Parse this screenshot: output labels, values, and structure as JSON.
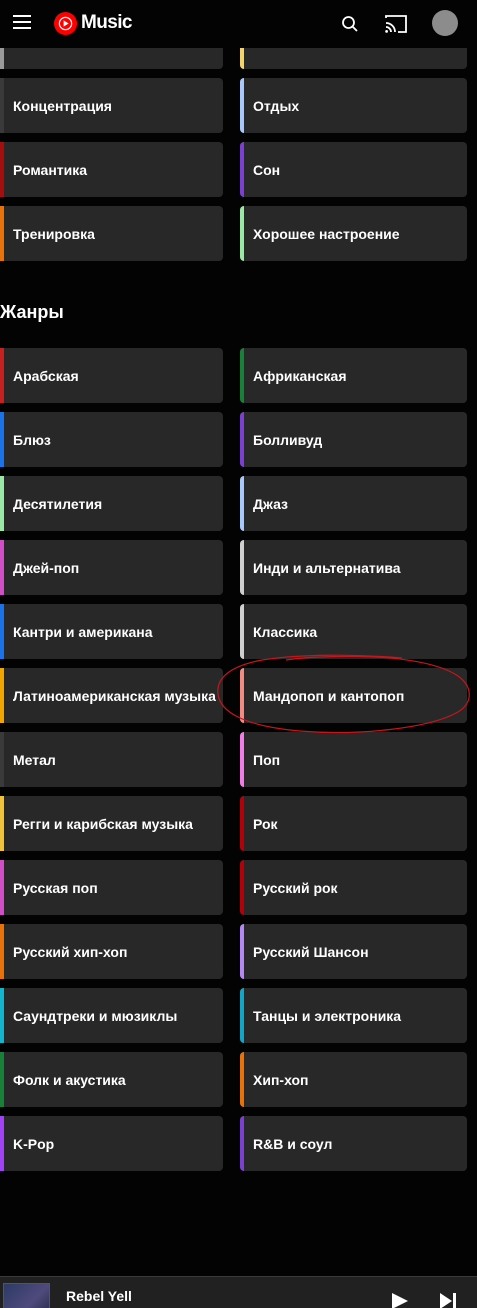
{
  "header": {
    "app_name": "Music",
    "icons": {
      "menu": "hamburger-menu-icon",
      "logo": "youtube-music-logo",
      "search": "search-icon",
      "cast": "cast-icon",
      "avatar": "account-avatar"
    }
  },
  "moods": {
    "tiles": [
      {
        "label": "",
        "color": "#9a9a9a"
      },
      {
        "label": "",
        "color": "#f5d36b"
      },
      {
        "label": "Концентрация",
        "color": "#3a3a3a"
      },
      {
        "label": "Отдых",
        "color": "#a8c7fa"
      },
      {
        "label": "Романтика",
        "color": "#a50e0e"
      },
      {
        "label": "Сон",
        "color": "#7b3fd1"
      },
      {
        "label": "Тренировка",
        "color": "#e8710a"
      },
      {
        "label": "Хорошее настроение",
        "color": "#9be7a5"
      }
    ]
  },
  "genres": {
    "title": "Жанры",
    "tiles": [
      {
        "label": "Арабская",
        "color": "#c5221f"
      },
      {
        "label": "Африканская",
        "color": "#188038"
      },
      {
        "label": "Блюз",
        "color": "#1a73e8"
      },
      {
        "label": "Болливуд",
        "color": "#7b3fd1"
      },
      {
        "label": "Десятилетия",
        "color": "#9be7a5"
      },
      {
        "label": "Джаз",
        "color": "#a8c7fa"
      },
      {
        "label": "Джей-поп",
        "color": "#d24ec7"
      },
      {
        "label": "Инди и альтернатива",
        "color": "#cfcfcf"
      },
      {
        "label": "Кантри и американа",
        "color": "#1a73e8"
      },
      {
        "label": "Классика",
        "color": "#cfcfcf"
      },
      {
        "label": "Латиноамериканская музыка",
        "color": "#f0a500"
      },
      {
        "label": "Мандопоп и кантопоп",
        "color": "#f28b82"
      },
      {
        "label": "Метал",
        "color": "#3a3a3a"
      },
      {
        "label": "Поп",
        "color": "#f27ce6"
      },
      {
        "label": "Регги и карибская музыка",
        "color": "#f0c23a"
      },
      {
        "label": "Рок",
        "color": "#b3000a"
      },
      {
        "label": "Русская поп",
        "color": "#d24ec7"
      },
      {
        "label": "Русский рок",
        "color": "#b3000a"
      },
      {
        "label": "Русский хип-хоп",
        "color": "#e8710a"
      },
      {
        "label": "Русский Шансон",
        "color": "#b388f5"
      },
      {
        "label": "Саундтреки и мюзиклы",
        "color": "#12b5cb"
      },
      {
        "label": "Танцы и электроника",
        "color": "#12a5c6"
      },
      {
        "label": "Фолк и акустика",
        "color": "#188038"
      },
      {
        "label": "Хип-хоп",
        "color": "#e8710a"
      },
      {
        "label": "K-Pop",
        "color": "#a142f4"
      },
      {
        "label": "R&B и соул",
        "color": "#7b3fd1"
      }
    ]
  },
  "player": {
    "track_title": "Rebel Yell",
    "icons": {
      "play": "play-icon",
      "next": "skip-next-icon",
      "thumbnail": "album-thumbnail"
    }
  }
}
